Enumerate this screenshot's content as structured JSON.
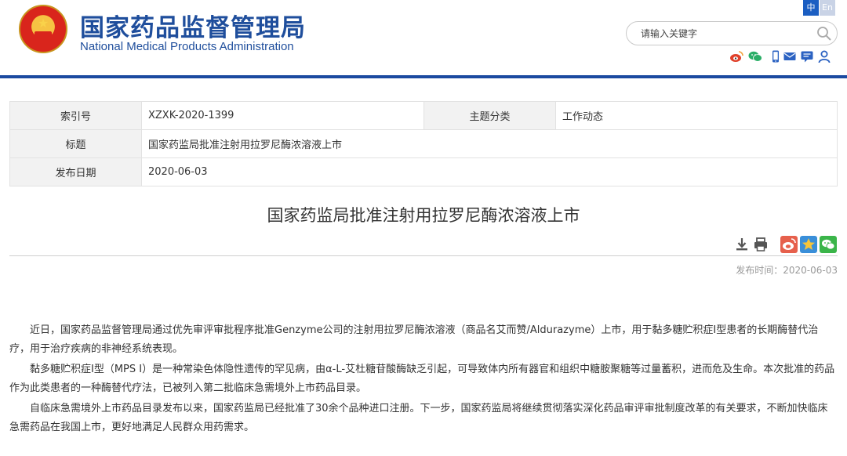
{
  "header": {
    "title_cn": "国家药品监督管理局",
    "title_en": "National Medical Products Administration",
    "lang_zh": "中",
    "lang_en": "En",
    "search_placeholder": "请输入关键字",
    "icons": [
      "weibo-icon",
      "wechat-icon",
      "mobile-icon",
      "mail-icon",
      "message-icon",
      "user-icon"
    ]
  },
  "meta": {
    "index_label": "索引号",
    "index_value": "XZXK-2020-1399",
    "category_label": "主题分类",
    "category_value": "工作动态",
    "title_label": "标题",
    "title_value": "国家药监局批准注射用拉罗尼酶浓溶液上市",
    "date_label": "发布日期",
    "date_value": "2020-06-03"
  },
  "article": {
    "title": "国家药监局批准注射用拉罗尼酶浓溶液上市",
    "publish_time": "发布时间：2020-06-03",
    "paragraphs": [
      "近日，国家药品监督管理局通过优先审评审批程序批准Genzyme公司的注射用拉罗尼酶浓溶液（商品名艾而赞/Aldurazyme）上市，用于黏多糖贮积症I型患者的长期酶替代治疗，用于治疗疾病的非神经系统表现。",
      "黏多糖贮积症I型（MPS I）是一种常染色体隐性遗传的罕见病，由α-L-艾杜糖苷酸酶缺乏引起，可导致体内所有器官和组织中糖胺聚糖等过量蓄积，进而危及生命。本次批准的药品作为此类患者的一种酶替代疗法，已被列入第二批临床急需境外上市药品目录。",
      "自临床急需境外上市药品目录发布以来，国家药监局已经批准了30余个品种进口注册。下一步，国家药监局将继续贯彻落实深化药品审评审批制度改革的有关要求，不断加快临床急需药品在我国上市，更好地满足人民群众用药需求。"
    ]
  },
  "colors": {
    "brand_blue": "#1f4e9c",
    "header_line": "#1b4aa0",
    "label_bg": "#f2f2f2"
  }
}
